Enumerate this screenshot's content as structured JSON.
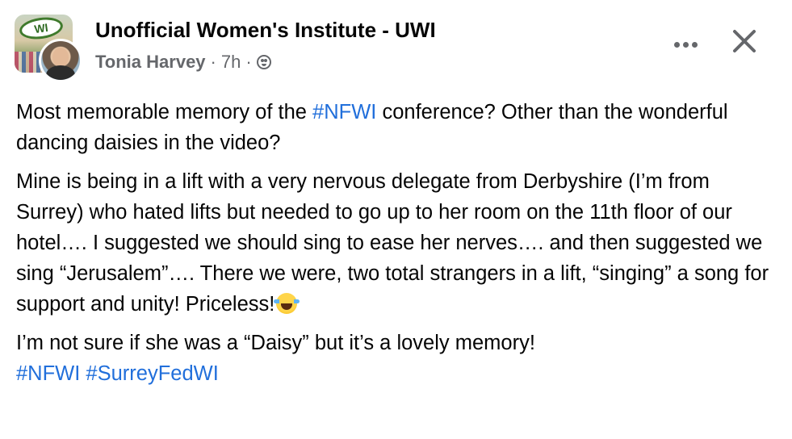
{
  "header": {
    "group_name": "Unofficial Women's Institute - UWI",
    "author": "Tonia Harvey",
    "time": "7h",
    "separator": "·",
    "group_badge_text": "WI",
    "privacy_icon": "audience-globe-icon",
    "more_icon": "more-options-icon",
    "close_icon": "close-icon"
  },
  "post": {
    "p1": {
      "before": "Most memorable memory of the ",
      "hashtag": "#NFWI",
      "after": " conference? Other than the wonderful dancing daisies in the video?"
    },
    "p2": {
      "text": "Mine is being in a lift with a very nervous delegate from Derbyshire (I’m from Surrey) who hated lifts but needed to go up to her room on the 11th floor of our hotel…. I suggested we should sing to ease her nerves…. and then suggested we sing “Jerusalem”…. There we were, two total strangers in a lift, “singing” a song for support and unity! Priceless!",
      "emoji": "laughing-crying-emoji"
    },
    "p3": {
      "text": "I’m not sure if she was a “Daisy” but it’s a lovely memory!",
      "hashtags": [
        "#NFWI",
        "#SurreyFedWI"
      ]
    }
  },
  "colors": {
    "hashtag": "#216fdb",
    "text": "#050505",
    "muted": "#65676b",
    "background": "#ffffff"
  }
}
